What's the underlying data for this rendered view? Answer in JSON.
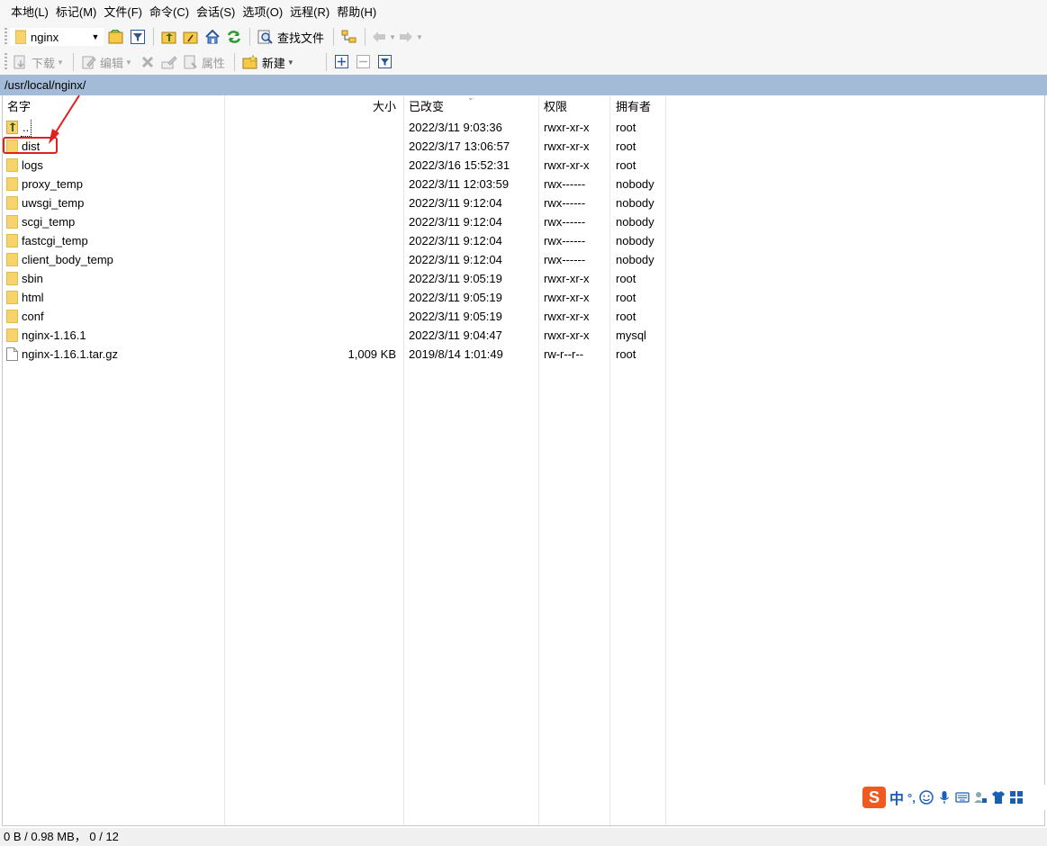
{
  "menu": [
    "本地(L)",
    "标记(M)",
    "文件(F)",
    "命令(C)",
    "会话(S)",
    "选项(O)",
    "远程(R)",
    "帮助(H)"
  ],
  "toolbar1": {
    "location": "nginx",
    "find_files": "查找文件"
  },
  "toolbar2": {
    "download": "下载",
    "edit": "编辑",
    "properties": "属性",
    "new": "新建"
  },
  "path": "/usr/local/nginx/",
  "columns": {
    "name": "名字",
    "size": "大小",
    "modified": "已改变",
    "permissions": "权限",
    "owner": "拥有者"
  },
  "files": [
    {
      "name": "..",
      "type": "parent",
      "size": "",
      "modified": "2022/3/11 9:03:36",
      "permissions": "rwxr-xr-x",
      "owner": "root"
    },
    {
      "name": "dist",
      "type": "folder",
      "size": "",
      "modified": "2022/3/17 13:06:57",
      "permissions": "rwxr-xr-x",
      "owner": "root",
      "highlighted": true
    },
    {
      "name": "logs",
      "type": "folder",
      "size": "",
      "modified": "2022/3/16 15:52:31",
      "permissions": "rwxr-xr-x",
      "owner": "root"
    },
    {
      "name": "proxy_temp",
      "type": "folder",
      "size": "",
      "modified": "2022/3/11 12:03:59",
      "permissions": "rwx------",
      "owner": "nobody"
    },
    {
      "name": "uwsgi_temp",
      "type": "folder",
      "size": "",
      "modified": "2022/3/11 9:12:04",
      "permissions": "rwx------",
      "owner": "nobody"
    },
    {
      "name": "scgi_temp",
      "type": "folder",
      "size": "",
      "modified": "2022/3/11 9:12:04",
      "permissions": "rwx------",
      "owner": "nobody"
    },
    {
      "name": "fastcgi_temp",
      "type": "folder",
      "size": "",
      "modified": "2022/3/11 9:12:04",
      "permissions": "rwx------",
      "owner": "nobody"
    },
    {
      "name": "client_body_temp",
      "type": "folder",
      "size": "",
      "modified": "2022/3/11 9:12:04",
      "permissions": "rwx------",
      "owner": "nobody"
    },
    {
      "name": "sbin",
      "type": "folder",
      "size": "",
      "modified": "2022/3/11 9:05:19",
      "permissions": "rwxr-xr-x",
      "owner": "root"
    },
    {
      "name": "html",
      "type": "folder",
      "size": "",
      "modified": "2022/3/11 9:05:19",
      "permissions": "rwxr-xr-x",
      "owner": "root"
    },
    {
      "name": "conf",
      "type": "folder",
      "size": "",
      "modified": "2022/3/11 9:05:19",
      "permissions": "rwxr-xr-x",
      "owner": "root"
    },
    {
      "name": "nginx-1.16.1",
      "type": "folder",
      "size": "",
      "modified": "2022/3/11 9:04:47",
      "permissions": "rwxr-xr-x",
      "owner": "mysql"
    },
    {
      "name": "nginx-1.16.1.tar.gz",
      "type": "file",
      "size": "1,009 KB",
      "modified": "2019/8/14 1:01:49",
      "permissions": "rw-r--r--",
      "owner": "root"
    }
  ],
  "status": "0 B / 0.98 MB，  0 / 12",
  "ime": {
    "lang": "中",
    "punct": "°,"
  },
  "colors": {
    "pathbar": "#a3bbd6",
    "highlight": "#e02020",
    "folder": "#f7d36b",
    "ime_brand": "#f05a1f"
  }
}
